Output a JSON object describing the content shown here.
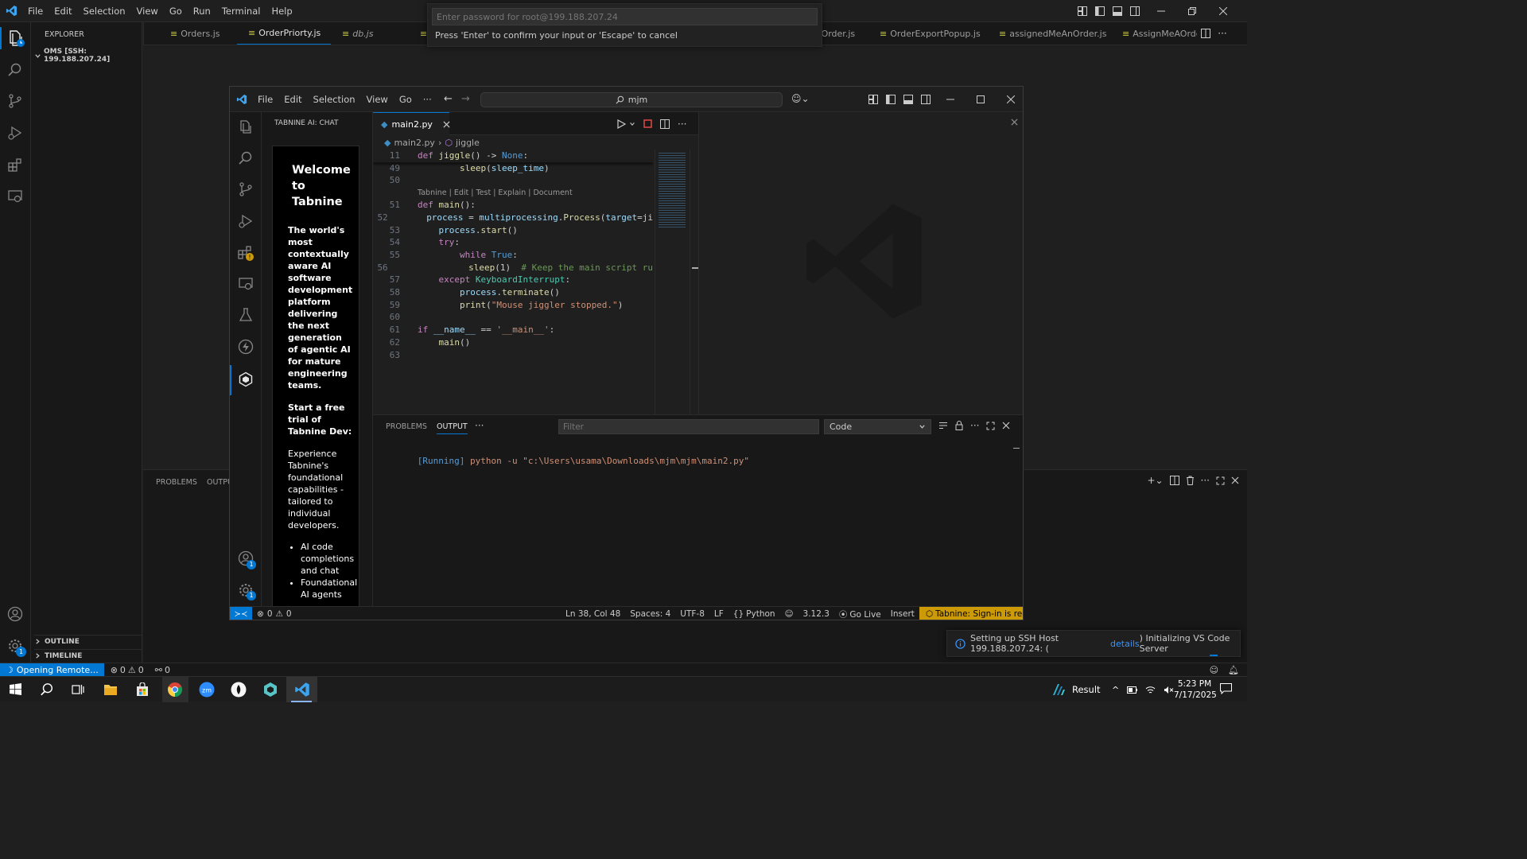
{
  "outer": {
    "menu": [
      "File",
      "Edit",
      "Selection",
      "View",
      "Go",
      "Run",
      "Terminal",
      "Help"
    ],
    "explorer_title": "EXPLORER",
    "workspace": "OMS [SSH: 199.188.207.24]",
    "tabs": [
      "Orders.js",
      "OrderPriorty.js",
      "db.js",
      "",
      "rtsOrder.js",
      "OrderExportPopup.js",
      "assignedMeAnOrder.js",
      "AssignMeAOrder"
    ],
    "outline": "OUTLINE",
    "timeline": "TIMELINE",
    "panel_tabs": [
      "PROBLEMS",
      "OUTPU"
    ],
    "remote_label": "Opening Remote...",
    "status_errors": "0",
    "status_warnings": "0",
    "status_ports": "0",
    "settings_badge": "1",
    "notification": {
      "prefix": "Setting up SSH Host 199.188.207.24: (",
      "link": "details",
      "suffix": ") Initializing VS Code Server"
    }
  },
  "quickinput": {
    "placeholder": "Enter password for root@199.188.207.24",
    "hint": "Press 'Enter' to confirm your input or 'Escape' to cancel"
  },
  "inner": {
    "menu": [
      "File",
      "Edit",
      "Selection",
      "View",
      "Go",
      "···"
    ],
    "search": "mjm",
    "sidebar_title": "TABNINE AI: CHAT",
    "chat": {
      "welcome": "Welcome to Tabnine",
      "tagline": "The world's most contextually aware AI software development platform delivering the next generation of agentic AI for mature engineering teams.",
      "trial": "Start a free trial of Tabnine Dev:",
      "desc": "Experience Tabnine's foundational capabilities - tailored to individual developers.",
      "bullets": [
        "AI code completions and chat",
        "Foundational AI agents"
      ]
    },
    "editor_tab": "main2.py",
    "breadcrumb_file": "main2.py",
    "breadcrumb_symbol": "jiggle",
    "codelens": "Tabnine | Edit | Test | Explain | Document",
    "code": [
      {
        "n": "11",
        "t": "def jiggle() -> None:"
      },
      {
        "n": "49",
        "t": "        sleep(sleep_time)"
      },
      {
        "n": "50",
        "t": ""
      },
      {
        "n": "51",
        "t": "def main():"
      },
      {
        "n": "52",
        "t": "    process = multiprocessing.Process(target=ji"
      },
      {
        "n": "53",
        "t": "    process.start()"
      },
      {
        "n": "54",
        "t": "    try:"
      },
      {
        "n": "55",
        "t": "        while True:"
      },
      {
        "n": "56",
        "t": "            sleep(1)  # Keep the main script ru"
      },
      {
        "n": "57",
        "t": "    except KeyboardInterrupt:"
      },
      {
        "n": "58",
        "t": "        process.terminate()"
      },
      {
        "n": "59",
        "t": "        print(\"Mouse jiggler stopped.\")"
      },
      {
        "n": "60",
        "t": ""
      },
      {
        "n": "61",
        "t": "if __name__ == '__main__':"
      },
      {
        "n": "62",
        "t": "    main()"
      },
      {
        "n": "63",
        "t": ""
      }
    ],
    "panel_tabs": [
      "PROBLEMS",
      "OUTPUT",
      "···"
    ],
    "filter_placeholder": "Filter",
    "output_channel": "Code",
    "output_running": "[Running]",
    "output_cmd": "python -u \"c:\\Users\\usama\\Downloads\\mjm\\mjm\\main2.py\"",
    "account_badge": "1",
    "settings_badge": "1",
    "status": {
      "errors": "0",
      "warnings": "0",
      "position": "Ln 38, Col 48",
      "spaces": "Spaces: 4",
      "encoding": "UTF-8",
      "eol": "LF",
      "language": "Python",
      "version": "3.12.3",
      "golive": "Go Live",
      "mode": "Insert",
      "tabnine": "Tabnine: Sign-in is required"
    }
  },
  "taskbar": {
    "result_label": "Result",
    "time": "5:23 PM",
    "date": "7/17/2025"
  },
  "colors": {
    "accent": "#0078d4",
    "tabnine_warning": "#cc9a06",
    "inner_remote": "#0078d4"
  }
}
